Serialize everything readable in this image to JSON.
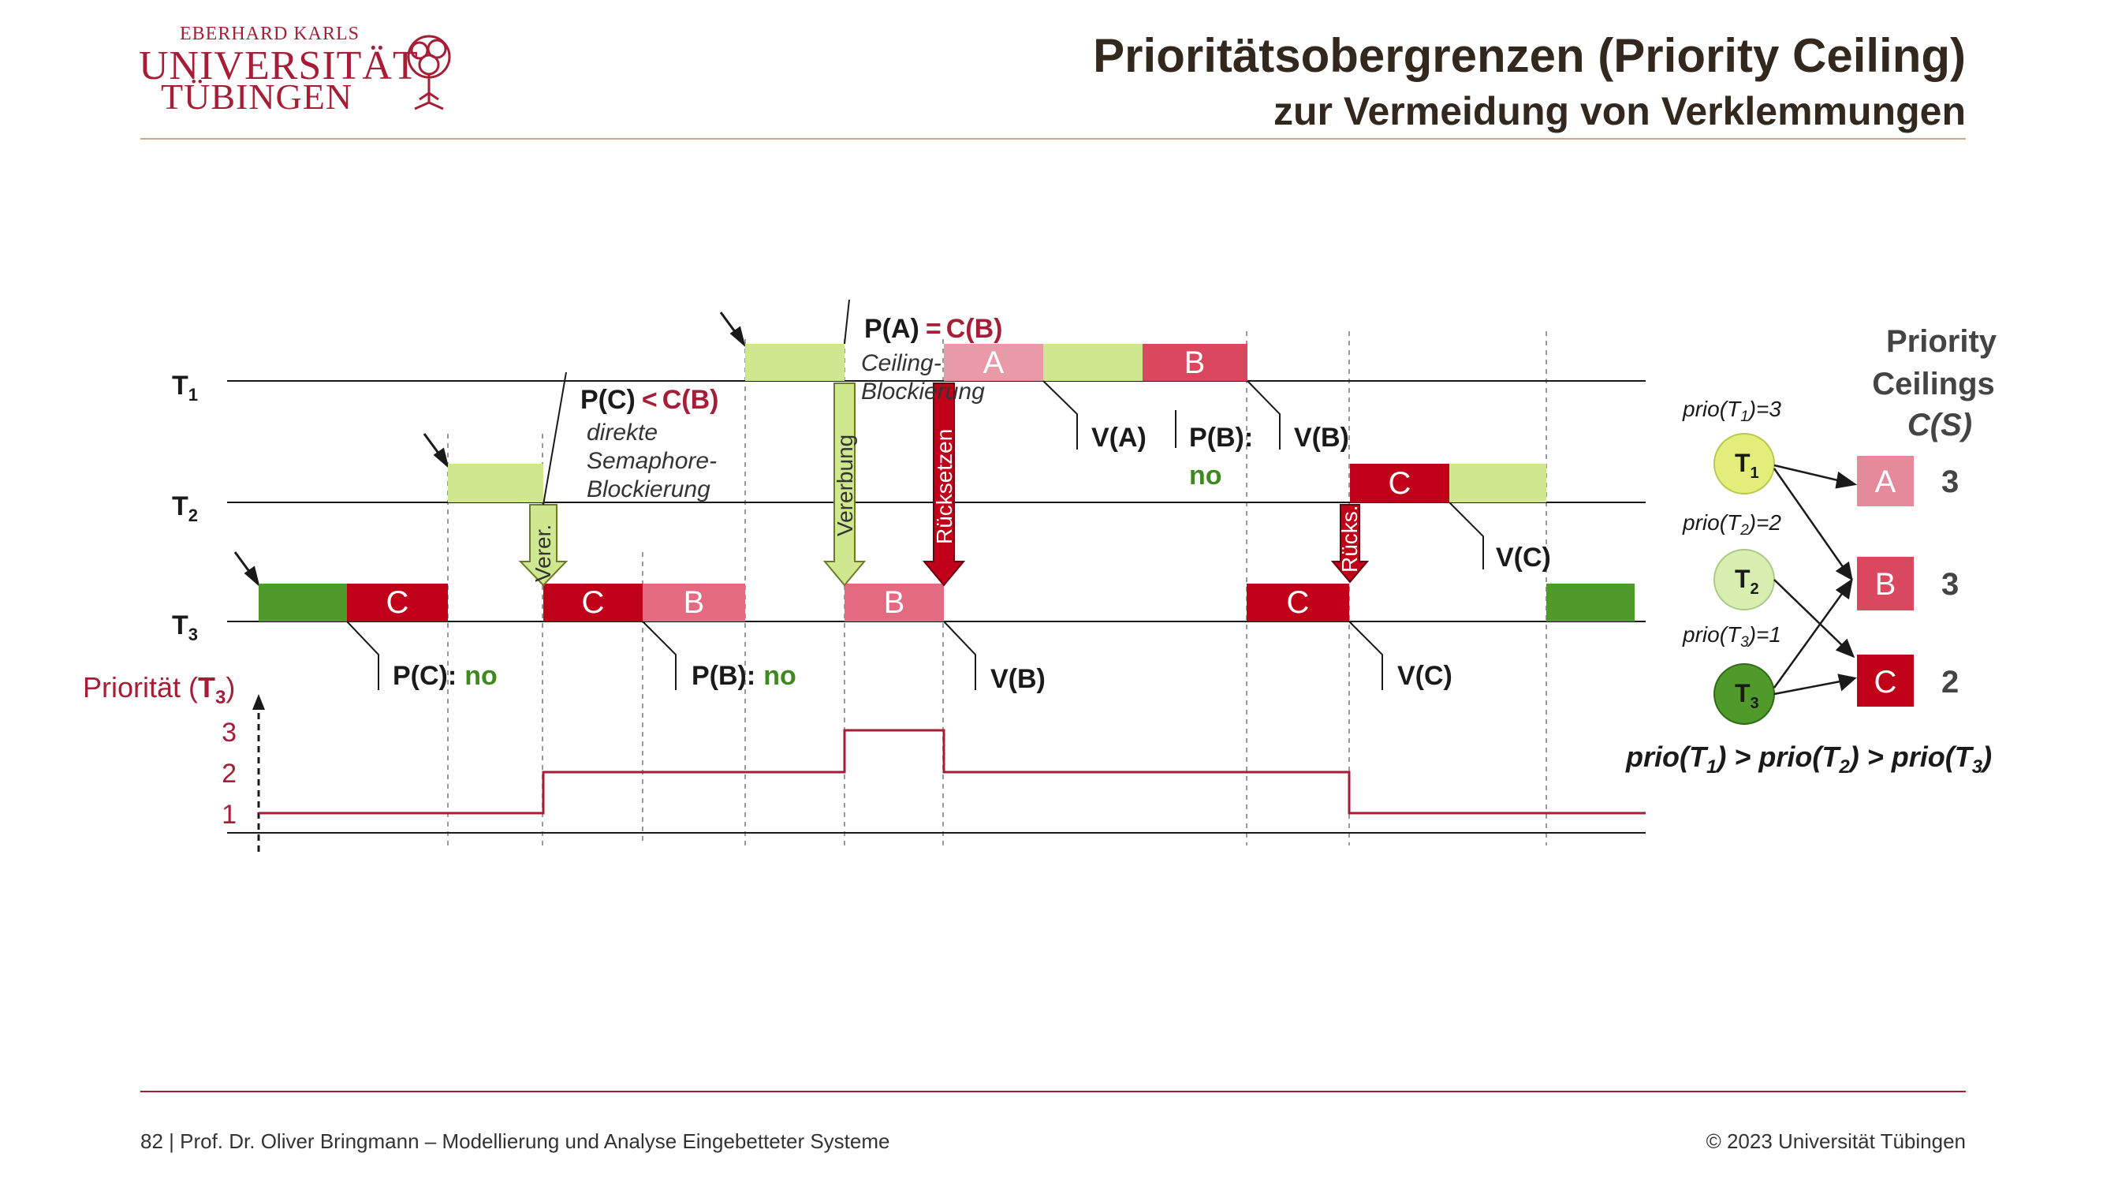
{
  "header": {
    "logo_line1": "EBERHARD KARLS",
    "logo_line2": "UNIVERSITÄT",
    "logo_line3": "TÜBINGEN",
    "title": "Prioritätsobergrenzen (Priority Ceiling)",
    "subtitle": "zur Vermeidung von Verklemmungen"
  },
  "tasks": {
    "t1": "T",
    "t1_sub": "1",
    "t2": "T",
    "t2_sub": "2",
    "t3": "T",
    "t3_sub": "3"
  },
  "blocks": {
    "a": "A",
    "b": "B",
    "c": "C"
  },
  "annotations": {
    "pa": "P(A)",
    "eq": "=",
    "cb": "C(B)",
    "ceiling_1": "Ceiling-",
    "ceiling_2": "Blockierung",
    "pc": "P(C)",
    "lt": "<",
    "cb2": "C(B)",
    "direkte_1": "direkte",
    "direkte_2": "Semaphore-",
    "direkte_3": "Blockierung",
    "va": "V(A)",
    "pb": "P(B):",
    "pb_no": "no",
    "vb_top": "V(B)",
    "vc_t2": "V(C)",
    "pc_t3": "P(C):",
    "pc_t3_no": "no",
    "pb_t3": "P(B):",
    "pb_t3_no": "no",
    "vb_t3": "V(B)",
    "vc_t3": "V(C)"
  },
  "arrows": {
    "verer": "Verer.",
    "vererbung": "Vererbung",
    "ruecksetzen": "Rücksetzen",
    "rucks": "Rücks."
  },
  "priority_chart": {
    "label": "Priorität (",
    "label_t": "T",
    "label_sub": "3",
    "label_end": ")",
    "ticks": [
      "1",
      "2",
      "3"
    ]
  },
  "ceilings": {
    "heading_1": "Priority",
    "heading_2": "Ceilings",
    "heading_3": "C(S)",
    "prio_t1": "prio(T1)=3",
    "prio_t2": "prio(T2)=2",
    "prio_t3": "prio(T3)=1",
    "resources": [
      {
        "name": "A",
        "ceiling": "3",
        "color": "#e58a9a"
      },
      {
        "name": "B",
        "ceiling": "3",
        "color": "#d9485f"
      },
      {
        "name": "C",
        "ceiling": "2",
        "color": "#c00018"
      }
    ],
    "order": "prio(T1) > prio(T2) > prio(T3)"
  },
  "footer": {
    "left": "82 | Prof. Dr. Oliver Bringmann – Modellierung und Analyse Eingebetteter Systeme",
    "right": "© 2023 Universität Tübingen"
  },
  "colors": {
    "accent": "#a51e36",
    "light_green": "#cfe88f",
    "dark_green": "#4f9a2a",
    "red": "#c00018",
    "pink": "#e58a9a",
    "mid_red": "#d9485f"
  }
}
